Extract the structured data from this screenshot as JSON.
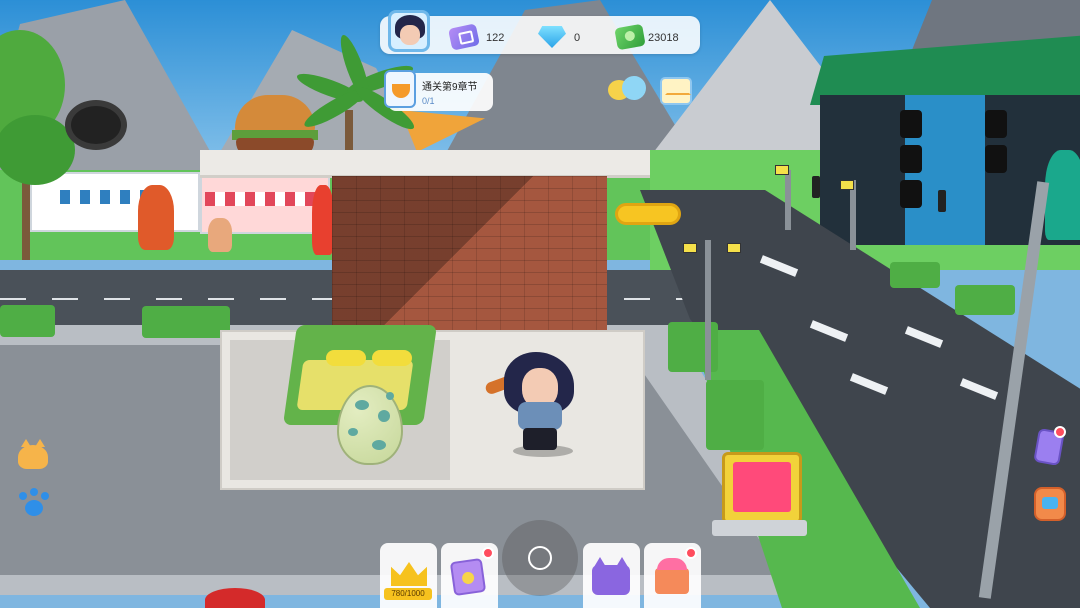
{
  "hud": {
    "currencies": [
      {
        "icon": "ticket-icon",
        "value": "122"
      },
      {
        "icon": "diamond-icon",
        "value": "0"
      },
      {
        "icon": "cash-icon",
        "value": "23018"
      }
    ]
  },
  "quest": {
    "title": "通关第9章节",
    "progress": "0/1"
  },
  "bottom_bar": {
    "crown_progress": "780/1000"
  },
  "colors": {
    "accent_blue": "#5b9fe0",
    "notification_red": "#ff4d5e",
    "crown_gold": "#f6c21e"
  },
  "icons": [
    "avatar",
    "ticket-icon",
    "diamond-icon",
    "cash-icon",
    "quest-clipboard-icon",
    "chat-icon",
    "mail-icon",
    "cat-icon",
    "paw-icon",
    "phone-icon",
    "backpack-icon",
    "crown-icon",
    "cards-icon",
    "cat-ears-icon",
    "cake-icon",
    "joystick"
  ]
}
